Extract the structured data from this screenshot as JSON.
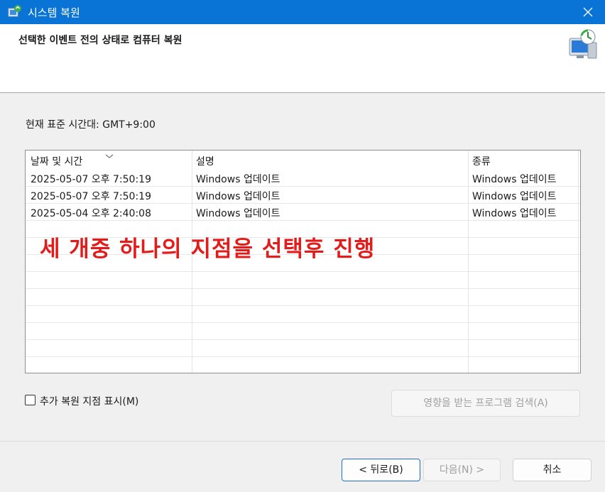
{
  "window": {
    "title": "시스템 복원"
  },
  "header": {
    "title": "선택한 이벤트 전의 상태로 컴퓨터 복원"
  },
  "timezone": {
    "label": "현재 표준 시간대: GMT+9:00"
  },
  "table": {
    "columns": [
      "날짜 및 시간",
      "설명",
      "종류"
    ],
    "rows": [
      {
        "date": "2025-05-07 오후 7:50:19",
        "description": "Windows 업데이트",
        "type": "Windows 업데이트"
      },
      {
        "date": "2025-05-07 오후 7:50:19",
        "description": "Windows 업데이트",
        "type": "Windows 업데이트"
      },
      {
        "date": "2025-05-04 오후 2:40:08",
        "description": "Windows 업데이트",
        "type": "Windows 업데이트"
      }
    ]
  },
  "annotation": {
    "text": "세 개중 하나의 지점을 선택후 진행"
  },
  "options": {
    "show_more_label": "추가 복원 지점 표시(M)",
    "show_more_checked": false,
    "scan_button_label": "영향을 받는 프로그램 검색(A)"
  },
  "footer": {
    "back_label": "< 뒤로(B)",
    "next_label": "다음(N) >",
    "cancel_label": "취소"
  },
  "colors": {
    "titlebar": "#0a74d6",
    "annotation": "#e21b1b",
    "primary_border": "#1e6fd0"
  }
}
